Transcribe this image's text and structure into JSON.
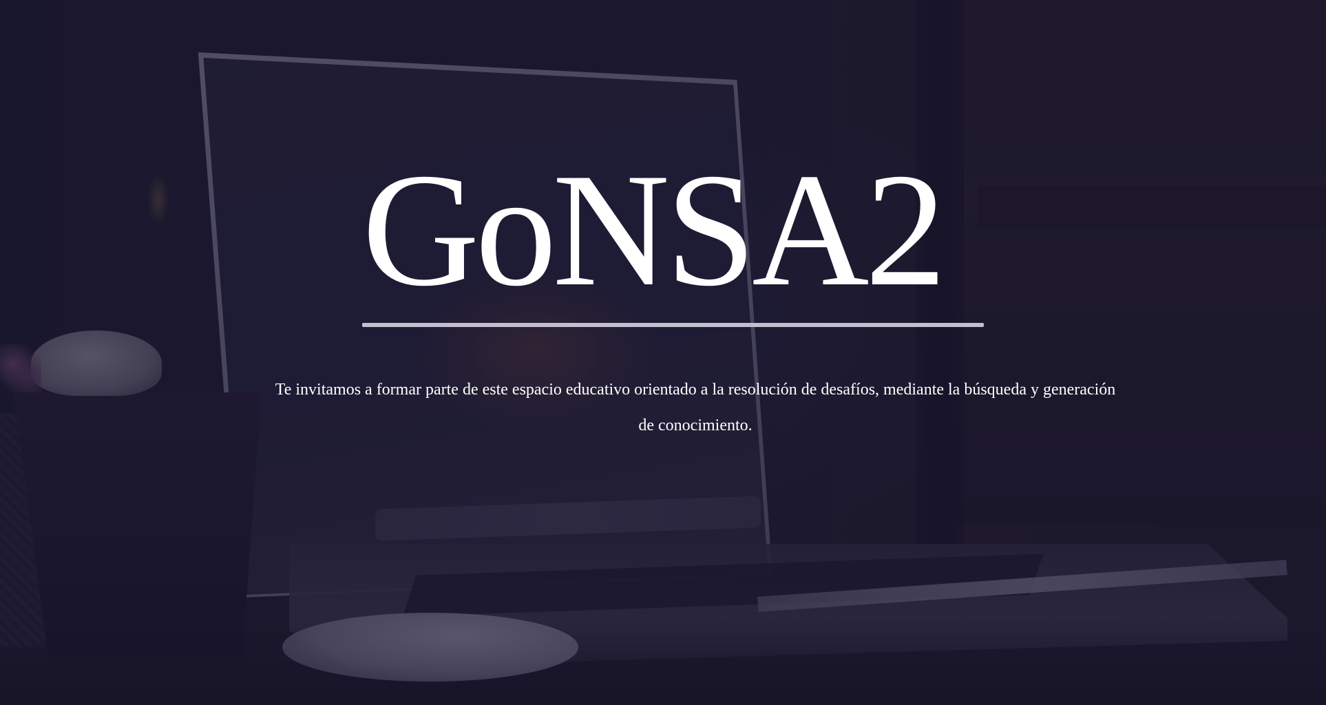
{
  "hero": {
    "title": "GoNSA2",
    "description": "Te invitamos a formar parte de este espacio educativo orientado a la resolución de desafíos, mediante la búsqueda y generación de conocimiento."
  },
  "background": {
    "image": "laptop-on-desk-photo",
    "overlay_color": "#16143099"
  },
  "colors": {
    "title": "#ffffff",
    "divider": "#c2bfce",
    "text": "#ffffff"
  }
}
